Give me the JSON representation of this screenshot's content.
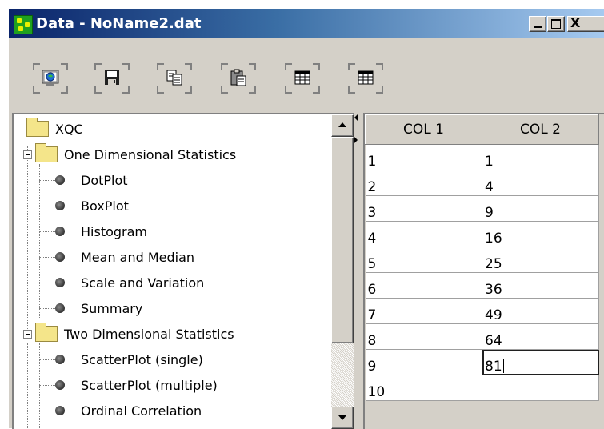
{
  "window": {
    "title": "Data - NoName2.dat",
    "buttons": {
      "minimize": "_",
      "maximize": "□",
      "close": "X"
    }
  },
  "toolbar": {
    "items": [
      {
        "name": "open",
        "icon": "open-data-icon"
      },
      {
        "name": "save",
        "icon": "save-disk-icon"
      },
      {
        "name": "copy",
        "icon": "copy-icon"
      },
      {
        "name": "paste",
        "icon": "paste-icon"
      },
      {
        "name": "table1",
        "icon": "table-icon"
      },
      {
        "name": "table2",
        "icon": "table-icon"
      }
    ]
  },
  "tree": {
    "root": "XQC",
    "groups": [
      {
        "label": "One Dimensional Statistics",
        "items": [
          "DotPlot",
          "BoxPlot",
          "Histogram",
          "Mean and Median",
          "Scale and Variation",
          "Summary"
        ]
      },
      {
        "label": "Two Dimensional Statistics",
        "items": [
          "ScatterPlot (single)",
          "ScatterPlot (multiple)",
          "Ordinal Correlation"
        ]
      }
    ]
  },
  "grid": {
    "columns": [
      "COL 1",
      "COL 2"
    ],
    "rows": [
      [
        "1",
        "1"
      ],
      [
        "2",
        "4"
      ],
      [
        "3",
        "9"
      ],
      [
        "4",
        "16"
      ],
      [
        "5",
        "25"
      ],
      [
        "6",
        "36"
      ],
      [
        "7",
        "49"
      ],
      [
        "8",
        "64"
      ],
      [
        "9",
        "81"
      ],
      [
        "10",
        ""
      ]
    ],
    "editing_cell": {
      "row": 9,
      "col": 2
    }
  }
}
